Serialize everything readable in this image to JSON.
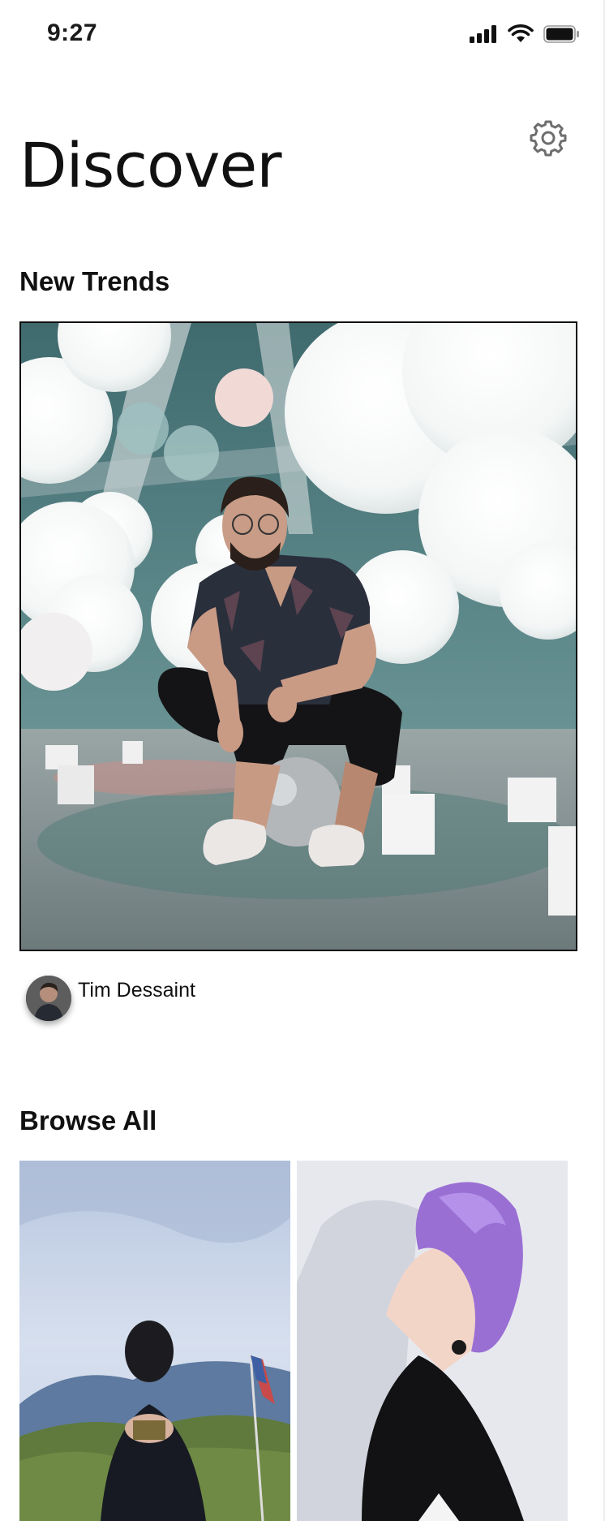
{
  "status_bar": {
    "time": "9:27",
    "icons": [
      "cellular-signal-icon",
      "wifi-icon",
      "battery-icon"
    ]
  },
  "header": {
    "title": "Discover",
    "settings_icon": "gear-icon"
  },
  "sections": {
    "new_trends": {
      "title": "New Trends",
      "featured": {
        "image": "man-crouching-among-white-balloons",
        "author": "Tim Dessaint"
      }
    },
    "browse_all": {
      "title": "Browse All",
      "tiles": [
        {
          "image": "person-holding-camera-outdoors"
        },
        {
          "image": "person-with-purple-hair"
        }
      ]
    }
  },
  "colors": {
    "background": "#ffffff",
    "text": "#111111",
    "icon": "#6e6e6e"
  }
}
